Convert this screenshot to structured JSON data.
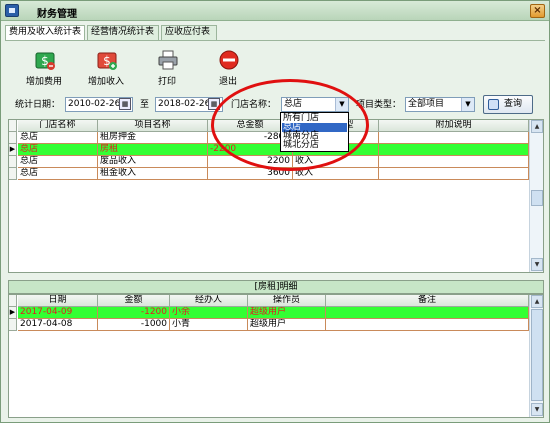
{
  "window": {
    "title": "财务管理",
    "close_glyph": "×"
  },
  "tabs": [
    {
      "label": "费用及收入统计表",
      "active": true
    },
    {
      "label": "经营情况统计表",
      "active": false
    },
    {
      "label": "应收应付表",
      "active": false
    }
  ],
  "toolbar": {
    "add_expense": "增加费用",
    "add_income": "增加收入",
    "print": "打印",
    "exit": "退出"
  },
  "filters": {
    "date_label": "统计日期：",
    "date_from": "2010-02-26",
    "date_to_label": "至",
    "date_to": "2018-02-26",
    "store_label": "门店名称：",
    "store_value": "总店",
    "type_label": "项目类型：",
    "type_value": "全部项目",
    "query_label": "查询"
  },
  "store_dropdown": {
    "options": [
      "所有门店",
      "总店",
      "城南分店",
      "城北分店"
    ],
    "highlighted": "总店"
  },
  "main_grid": {
    "columns": [
      "门店名称",
      "项目名称",
      "总金额",
      "项目类型",
      "附加说明"
    ],
    "rows": [
      {
        "store": "总店",
        "item": "租房押金",
        "amount": "-2800",
        "type": "",
        "note": ""
      },
      {
        "store": "总店",
        "item": "房租",
        "amount": "-2200",
        "type": "",
        "note": "",
        "selected": true
      },
      {
        "store": "总店",
        "item": "废品收入",
        "amount": "2200",
        "type": "收入",
        "note": ""
      },
      {
        "store": "总店",
        "item": "租金收入",
        "amount": "3600",
        "type": "收入",
        "note": ""
      }
    ]
  },
  "detail_title": "[房租]明细",
  "detail_grid": {
    "columns": [
      "日期",
      "金额",
      "经办人",
      "操作员",
      "备注"
    ],
    "rows": [
      {
        "date": "2017-04-09",
        "amount": "-1200",
        "handler": "小余",
        "operator": "超级用户",
        "note": "",
        "selected": true
      },
      {
        "date": "2017-04-08",
        "amount": "-1000",
        "handler": "小青",
        "operator": "超级用户",
        "note": ""
      }
    ]
  },
  "icons": {
    "add_expense": "money-minus-icon",
    "add_income": "money-plus-icon",
    "print": "printer-icon",
    "exit": "stop-icon",
    "query": "magnifier-icon"
  },
  "colors": {
    "selected_row": "#33ff33",
    "selected_text": "#e02020",
    "annotation": "#e01010"
  }
}
